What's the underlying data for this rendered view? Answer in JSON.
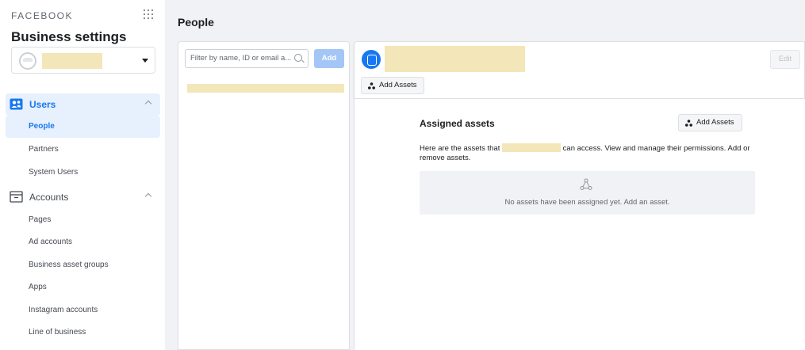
{
  "sidebar": {
    "brand": "FACEBOOK",
    "title": "Business settings",
    "groups": [
      {
        "label": "Users",
        "items": [
          {
            "label": "People"
          },
          {
            "label": "Partners"
          },
          {
            "label": "System Users"
          }
        ]
      },
      {
        "label": "Accounts",
        "items": [
          {
            "label": "Pages"
          },
          {
            "label": "Ad accounts"
          },
          {
            "label": "Business asset groups"
          },
          {
            "label": "Apps"
          },
          {
            "label": "Instagram accounts"
          },
          {
            "label": "Line of business"
          }
        ]
      }
    ]
  },
  "main": {
    "page_title": "People",
    "filter_placeholder": "Filter by name, ID or email a...",
    "add_label": "Add",
    "detail": {
      "add_assets_label": "Add Assets",
      "edit_label": "Edit",
      "assigned_title": "Assigned assets",
      "desc_before": "Here are the assets that ",
      "desc_after": " can access. View and manage their permissions. Add or remove assets.",
      "empty_text": "No assets have been assigned yet. Add an asset."
    }
  },
  "colors": {
    "accent": "#1877f2",
    "active_bg": "#e7f0fd",
    "redaction": "#f3e6b8",
    "disabled_button": "#a4c6f7"
  }
}
